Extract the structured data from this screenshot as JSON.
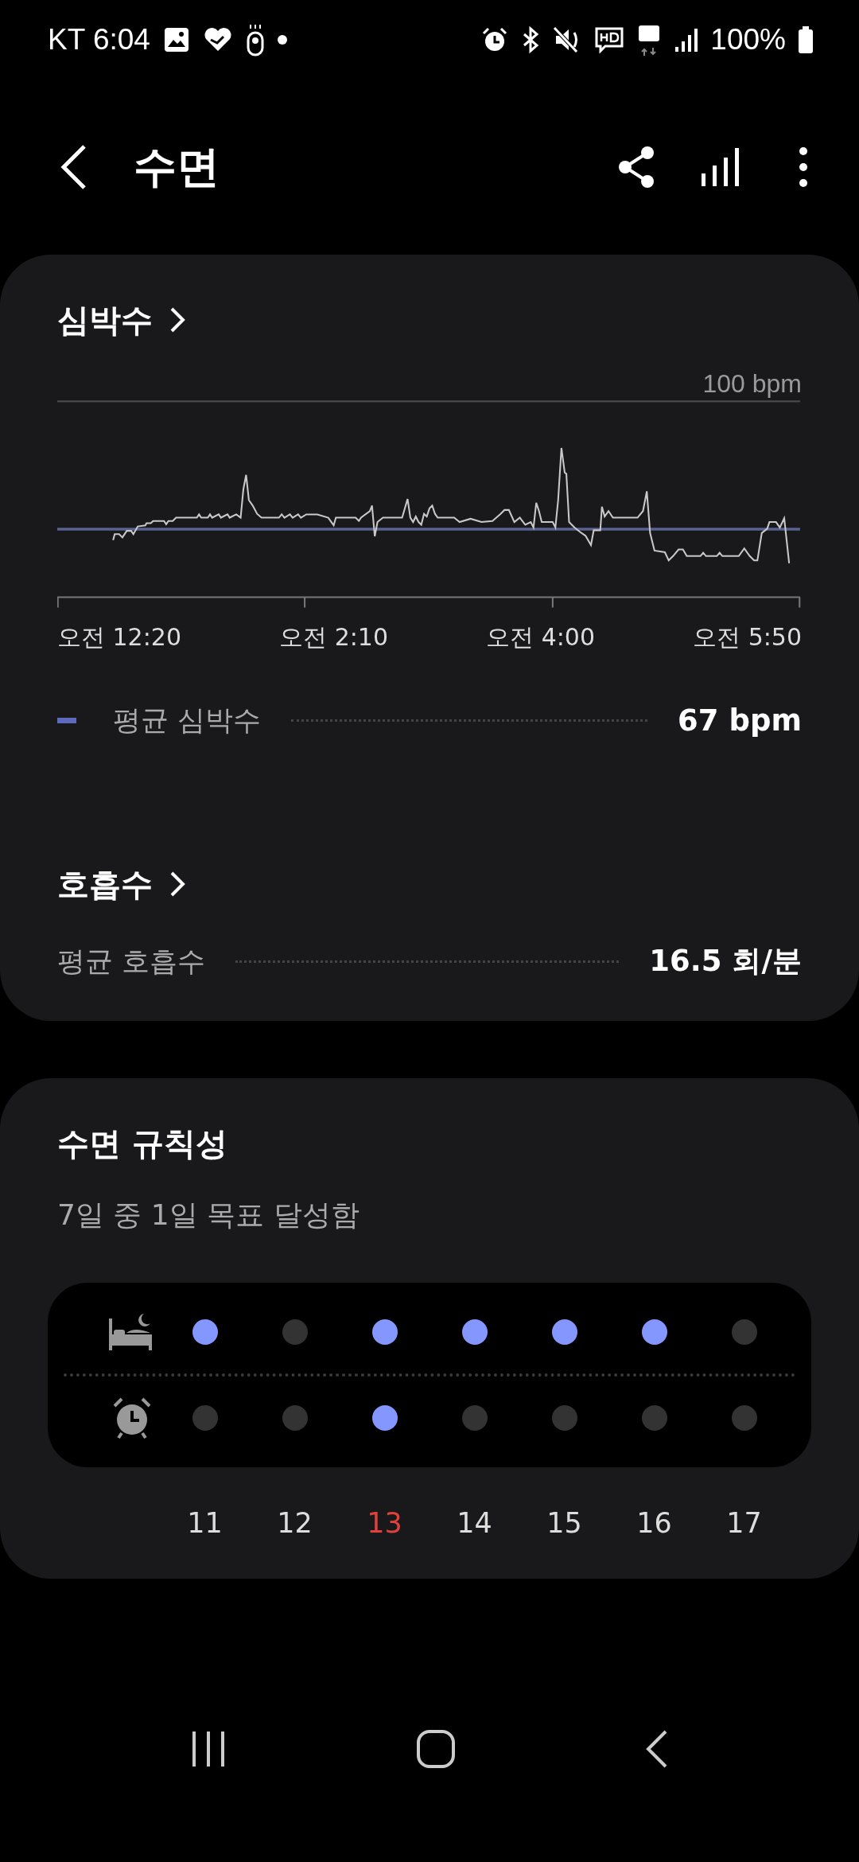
{
  "status_bar": {
    "carrier_time": "KT 6:04",
    "battery": "100%"
  },
  "header": {
    "title": "수면"
  },
  "heart_rate": {
    "title": "심박수",
    "max_label": "100 bpm",
    "time_labels": [
      "오전 12:20",
      "오전 2:10",
      "오전 4:00",
      "오전 5:50"
    ],
    "average": {
      "label": "평균 심박수",
      "value": "67 bpm"
    }
  },
  "respiration": {
    "title": "호흡수",
    "average": {
      "label": "평균 호흡수",
      "value": "16.5 회/분"
    }
  },
  "regularity": {
    "title": "수면 규칙성",
    "summary": "7일 중 1일 목표 달성함",
    "days": [
      {
        "date": "11",
        "bedtime_met": true,
        "wake_met": false,
        "sunday": false
      },
      {
        "date": "12",
        "bedtime_met": false,
        "wake_met": false,
        "sunday": false
      },
      {
        "date": "13",
        "bedtime_met": true,
        "wake_met": true,
        "sunday": true
      },
      {
        "date": "14",
        "bedtime_met": true,
        "wake_met": false,
        "sunday": false
      },
      {
        "date": "15",
        "bedtime_met": true,
        "wake_met": false,
        "sunday": false
      },
      {
        "date": "16",
        "bedtime_met": true,
        "wake_met": false,
        "sunday": false
      },
      {
        "date": "17",
        "bedtime_met": false,
        "wake_met": false,
        "sunday": false
      }
    ]
  }
}
